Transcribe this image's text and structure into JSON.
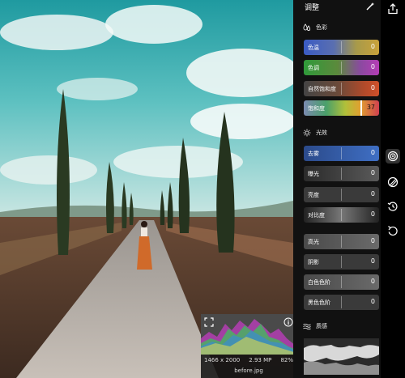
{
  "panel": {
    "title": "调整",
    "color_section": {
      "title": "色彩",
      "sliders": [
        {
          "label": "色温",
          "value": "0"
        },
        {
          "label": "色调",
          "value": "0"
        },
        {
          "label": "自然饱和度",
          "value": "0"
        },
        {
          "label": "饱和度",
          "value": "37",
          "level": 0.74
        }
      ]
    },
    "light_section": {
      "title": "光效",
      "sliders": [
        {
          "label": "去雾",
          "value": "0"
        },
        {
          "label": "曝光",
          "value": "0"
        },
        {
          "label": "亮度",
          "value": "0"
        },
        {
          "label": "对比度",
          "value": "0"
        },
        {
          "label": "高光",
          "value": "0"
        },
        {
          "label": "阴影",
          "value": "0"
        },
        {
          "label": "白色色阶",
          "value": "0"
        },
        {
          "label": "黑色色阶",
          "value": "0"
        }
      ]
    },
    "texture_section": {
      "title": "质感"
    }
  },
  "histogram": {
    "dimensions": "1466 x 2000",
    "megapixels": "2.93 MP",
    "zoom": "82%",
    "filename": "before.jpg"
  },
  "icons": {
    "top_wand": "magic-wand-icon",
    "top_share": "share-icon",
    "tool_1": "adjust-icon",
    "tool_2": "slash-icon",
    "tool_3": "history-icon",
    "tool_4": "undo-icon"
  }
}
